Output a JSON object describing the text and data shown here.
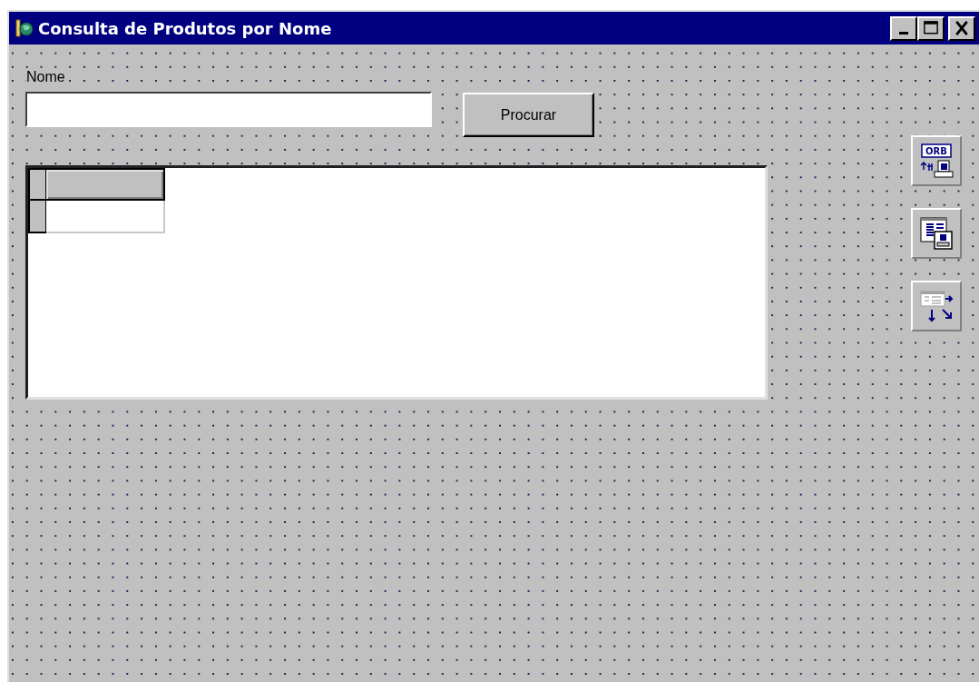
{
  "window": {
    "title": "Consulta de Produtos por Nome"
  },
  "form": {
    "name_label": "Nome",
    "search_button": "Procurar"
  },
  "grid": {
    "columns": [
      {
        "kind": "text"
      }
    ],
    "rows": [
      {
        "selected": false
      }
    ]
  },
  "components": [
    {
      "kind": "orb",
      "label": "ORB"
    },
    {
      "kind": "datasource"
    },
    {
      "kind": "navigator"
    }
  ]
}
